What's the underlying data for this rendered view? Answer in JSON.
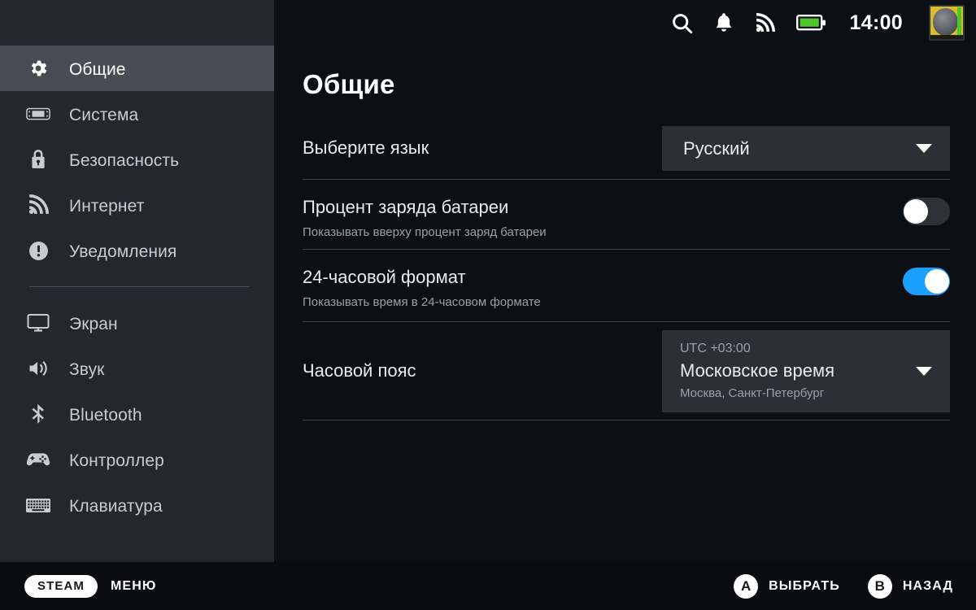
{
  "sidebar": {
    "items": [
      {
        "label": "Общие",
        "icon": "gear-icon",
        "selected": true
      },
      {
        "label": "Система",
        "icon": "handheld-icon",
        "selected": false
      },
      {
        "label": "Безопасность",
        "icon": "lock-icon",
        "selected": false
      },
      {
        "label": "Интернет",
        "icon": "wifi-icon",
        "selected": false
      },
      {
        "label": "Уведомления",
        "icon": "alert-icon",
        "selected": false
      },
      {
        "label": "Экран",
        "icon": "monitor-icon",
        "selected": false
      },
      {
        "label": "Звук",
        "icon": "speaker-icon",
        "selected": false
      },
      {
        "label": "Bluetooth",
        "icon": "bluetooth-icon",
        "selected": false
      },
      {
        "label": "Контроллер",
        "icon": "gamepad-icon",
        "selected": false
      },
      {
        "label": "Клавиатура",
        "icon": "keyboard-icon",
        "selected": false
      }
    ]
  },
  "statusbar": {
    "icons": [
      "search-icon",
      "bell-icon",
      "wifi-icon",
      "battery-icon"
    ],
    "time": "14:00",
    "battery_color": "#4fc72a"
  },
  "main": {
    "title": "Общие",
    "rows": {
      "language": {
        "title": "Выберите язык",
        "value": "Русский"
      },
      "battery_percent": {
        "title": "Процент заряда батареи",
        "description": "Показывать вверху процент заряд батареи",
        "state": "off"
      },
      "clock_24h": {
        "title": "24-часовой формат",
        "description": "Показывать время в 24-часовом формате",
        "state": "on"
      },
      "timezone": {
        "title": "Часовой пояс",
        "utc": "UTC +03:00",
        "name": "Московское время",
        "cities": "Москва, Санкт-Петербург"
      }
    }
  },
  "footer": {
    "steam_pill": "STEAM",
    "menu_label": "МЕНЮ",
    "hints": [
      {
        "button": "A",
        "label": "ВЫБРАТЬ"
      },
      {
        "button": "B",
        "label": "НАЗАД"
      }
    ]
  },
  "colors": {
    "accent_blue": "#1a9fff",
    "sidebar_bg": "#23272e",
    "selected_bg": "#484d55",
    "main_bg": "#0c1014",
    "dropdown_bg": "#2b2f36"
  }
}
